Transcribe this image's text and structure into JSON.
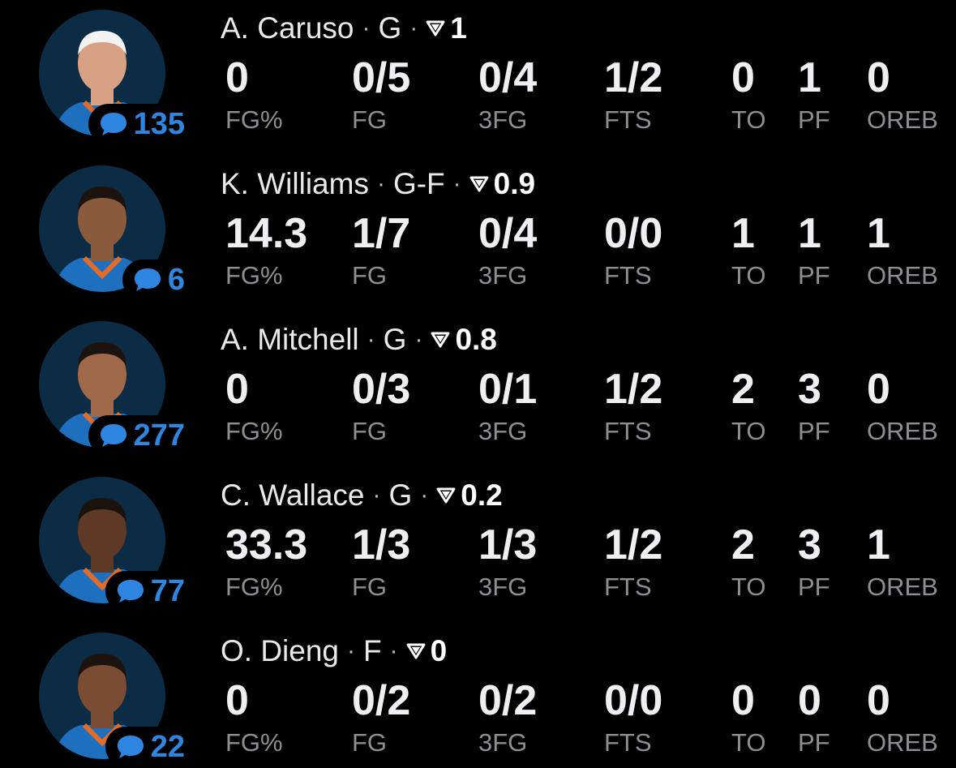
{
  "colors": {
    "background": "#000000",
    "comment_accent": "#2f86e0",
    "label_gray": "#8e8e93",
    "jersey_blue": "#1f6fbf",
    "jersey_orange": "#e46a25"
  },
  "icons": {
    "comment": "speech-bubble-icon",
    "rating": "down-triangle-icon",
    "avatar": "player-headshot"
  },
  "stat_labels": [
    "FG%",
    "FG",
    "3FG",
    "FTS",
    "TO",
    "PF",
    "OREB"
  ],
  "players": [
    {
      "name": "A. Caruso",
      "position": "G",
      "separator": "·",
      "rating": "1",
      "comments": "135",
      "stats": [
        "0",
        "0/5",
        "0/4",
        "1/2",
        "0",
        "1",
        "0"
      ]
    },
    {
      "name": "K. Williams",
      "position": "G-F",
      "separator": "·",
      "rating": "0.9",
      "comments": "6",
      "stats": [
        "14.3",
        "1/7",
        "0/4",
        "0/0",
        "1",
        "1",
        "1"
      ]
    },
    {
      "name": "A. Mitchell",
      "position": "G",
      "separator": "·",
      "rating": "0.8",
      "comments": "277",
      "stats": [
        "0",
        "0/3",
        "0/1",
        "1/2",
        "2",
        "3",
        "0"
      ]
    },
    {
      "name": "C. Wallace",
      "position": "G",
      "separator": "·",
      "rating": "0.2",
      "comments": "77",
      "stats": [
        "33.3",
        "1/3",
        "1/3",
        "1/2",
        "2",
        "3",
        "1"
      ]
    },
    {
      "name": "O. Dieng",
      "position": "F",
      "separator": "·",
      "rating": "0",
      "comments": "22",
      "stats": [
        "0",
        "0/2",
        "0/2",
        "0/0",
        "0",
        "0",
        "0"
      ]
    }
  ]
}
